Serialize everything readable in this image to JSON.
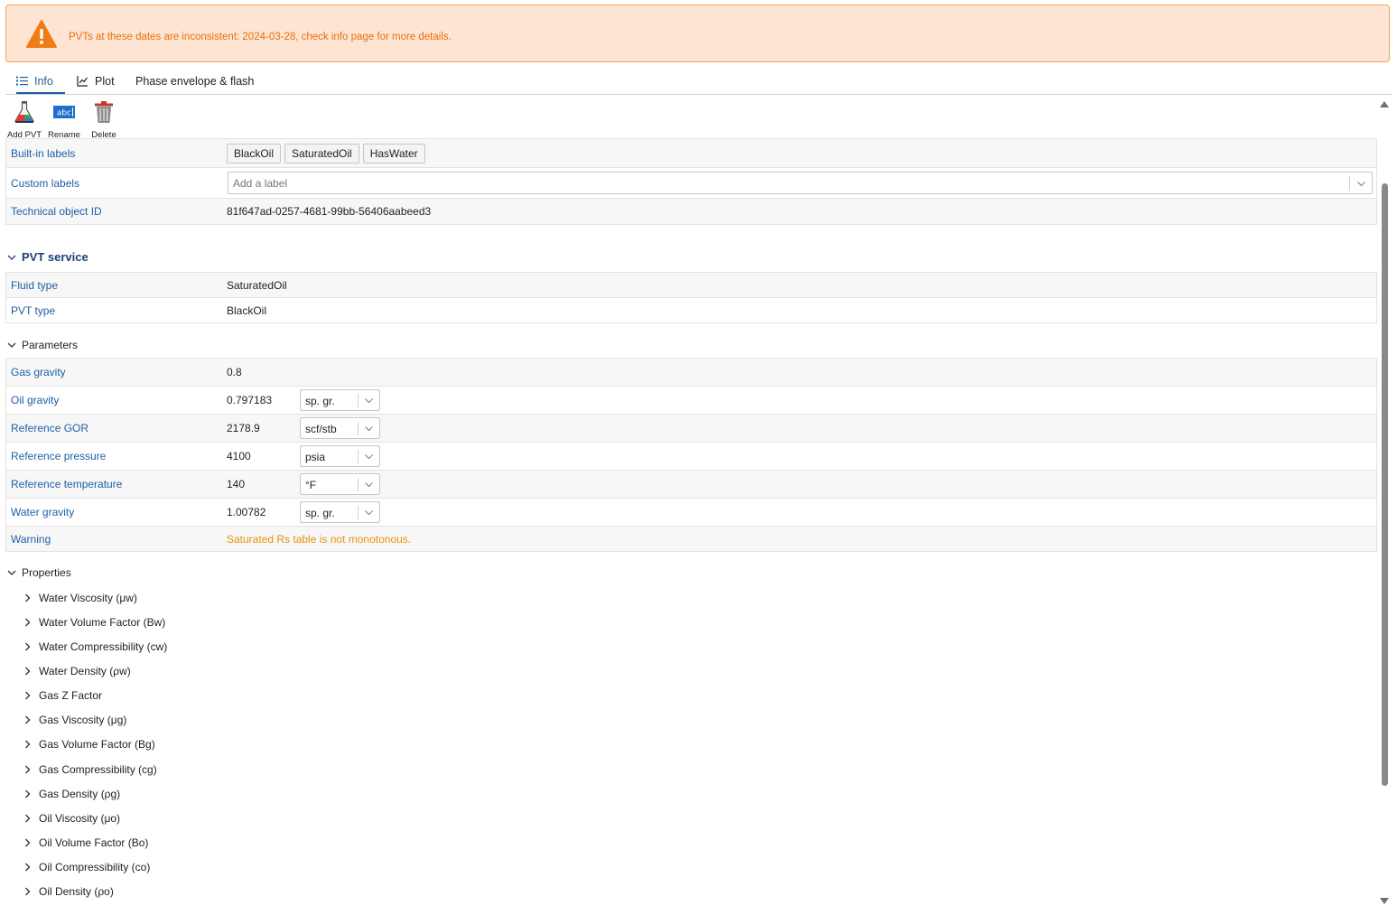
{
  "banner": {
    "message": "PVTs at these dates are inconsistent: 2024-03-28, check info page for more details."
  },
  "tabs": [
    {
      "label": "Info",
      "icon": "list-icon"
    },
    {
      "label": "Plot",
      "icon": "line-chart-icon"
    },
    {
      "label": "Phase envelope & flash"
    }
  ],
  "toolbar": {
    "add_pvt": "Add PVT",
    "rename": "Rename",
    "delete": "Delete"
  },
  "general": {
    "builtin_labels_key": "Built-in labels",
    "builtin_labels": [
      "BlackOil",
      "SaturatedOil",
      "HasWater"
    ],
    "custom_labels_key": "Custom labels",
    "custom_labels_placeholder": "Add a label",
    "object_id_key": "Technical object ID",
    "object_id": "81f647ad-0257-4681-99bb-56406aabeed3"
  },
  "pvt_service": {
    "title": "PVT service",
    "fluid_type_key": "Fluid type",
    "fluid_type": "SaturatedOil",
    "pvt_type_key": "PVT type",
    "pvt_type": "BlackOil"
  },
  "parameters": {
    "title": "Parameters",
    "gas_gravity_key": "Gas gravity",
    "gas_gravity": "0.8",
    "oil_gravity_key": "Oil gravity",
    "oil_gravity": "0.797183",
    "oil_gravity_unit": "sp. gr.",
    "ref_gor_key": "Reference GOR",
    "ref_gor": "2178.9",
    "ref_gor_unit": "scf/stb",
    "ref_pressure_key": "Reference pressure",
    "ref_pressure": "4100",
    "ref_pressure_unit": "psia",
    "ref_temp_key": "Reference temperature",
    "ref_temp": "140",
    "ref_temp_unit": "°F",
    "water_gravity_key": "Water gravity",
    "water_gravity": "1.00782",
    "water_gravity_unit": "sp. gr.",
    "warning_key": "Warning",
    "warning": "Saturated Rs table is not monotonous."
  },
  "properties": {
    "title": "Properties",
    "items": [
      "Water Viscosity (μw)",
      "Water Volume Factor (Bw)",
      "Water Compressibility (cw)",
      "Water Density (ρw)",
      "Gas Z Factor",
      "Gas Viscosity (μg)",
      "Gas Volume Factor (Bg)",
      "Gas Compressibility (cg)",
      "Gas Density (ρg)",
      "Oil Viscosity (μo)",
      "Oil Volume Factor (Bo)",
      "Oil Compressibility (co)",
      "Oil Density (ρo)"
    ]
  },
  "colors": {
    "accent": "#1f5fa6",
    "warning": "#e8720c",
    "banner_bg": "#fde4d3"
  }
}
